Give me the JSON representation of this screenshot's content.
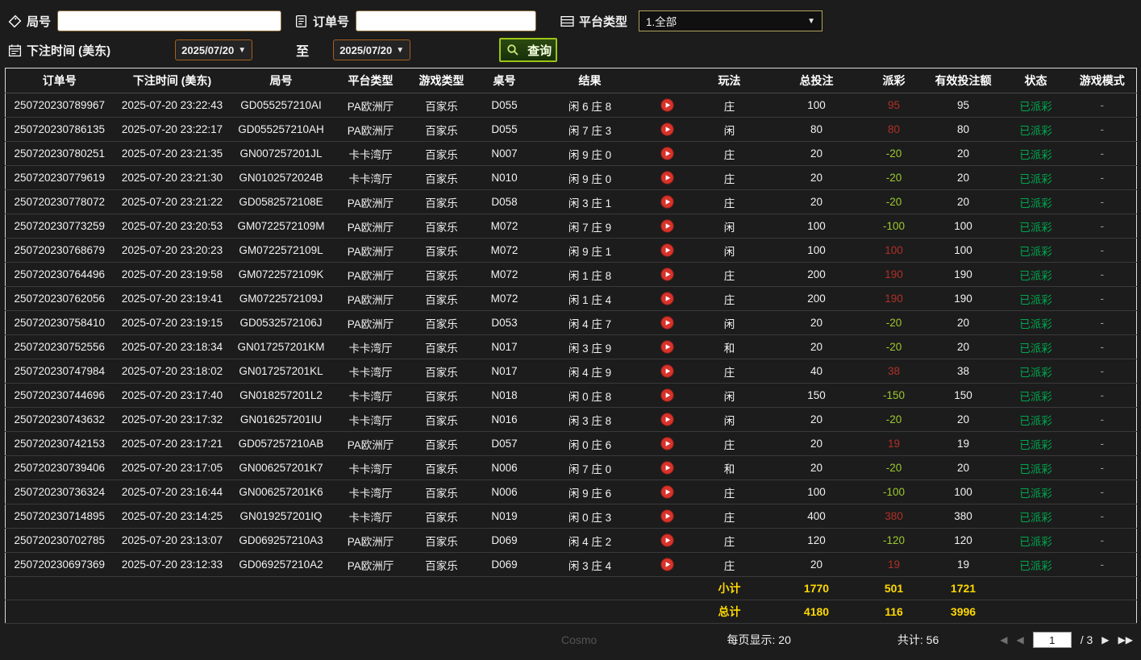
{
  "filters": {
    "round_label": "局号",
    "round_value": "",
    "order_label": "订单号",
    "order_value": "",
    "platform_label": "平台类型",
    "platform_value": "1.全部",
    "bet_time_label": "下注时间 (美东)",
    "date_from": "2025/07/20",
    "to_label": "至",
    "date_to": "2025/07/20",
    "search_label": "查询"
  },
  "table": {
    "headers": [
      "订单号",
      "下注时间 (美东)",
      "局号",
      "平台类型",
      "游戏类型",
      "桌号",
      "结果",
      "",
      "玩法",
      "总投注",
      "派彩",
      "有效投注额",
      "状态",
      "游戏模式"
    ],
    "rows": [
      {
        "order": "250720230789967",
        "time": "2025-07-20 23:22:43",
        "round": "GD055257210AI",
        "platform": "PA欧洲厅",
        "game": "百家乐",
        "table_no": "D055",
        "result": "闲 6 庄 8",
        "play": "庄",
        "total_bet": "100",
        "payout": "95",
        "payout_type": "win",
        "valid_bet": "95",
        "status": "已派彩",
        "mode": "-"
      },
      {
        "order": "250720230786135",
        "time": "2025-07-20 23:22:17",
        "round": "GD055257210AH",
        "platform": "PA欧洲厅",
        "game": "百家乐",
        "table_no": "D055",
        "result": "闲 7 庄 3",
        "play": "闲",
        "total_bet": "80",
        "payout": "80",
        "payout_type": "win",
        "valid_bet": "80",
        "status": "已派彩",
        "mode": "-"
      },
      {
        "order": "250720230780251",
        "time": "2025-07-20 23:21:35",
        "round": "GN007257201JL",
        "platform": "卡卡湾厅",
        "game": "百家乐",
        "table_no": "N007",
        "result": "闲 9 庄 0",
        "play": "庄",
        "total_bet": "20",
        "payout": "-20",
        "payout_type": "loss",
        "valid_bet": "20",
        "status": "已派彩",
        "mode": "-"
      },
      {
        "order": "250720230779619",
        "time": "2025-07-20 23:21:30",
        "round": "GN0102572024B",
        "platform": "卡卡湾厅",
        "game": "百家乐",
        "table_no": "N010",
        "result": "闲 9 庄 0",
        "play": "庄",
        "total_bet": "20",
        "payout": "-20",
        "payout_type": "loss",
        "valid_bet": "20",
        "status": "已派彩",
        "mode": "-"
      },
      {
        "order": "250720230778072",
        "time": "2025-07-20 23:21:22",
        "round": "GD0582572108E",
        "platform": "PA欧洲厅",
        "game": "百家乐",
        "table_no": "D058",
        "result": "闲 3 庄 1",
        "play": "庄",
        "total_bet": "20",
        "payout": "-20",
        "payout_type": "loss",
        "valid_bet": "20",
        "status": "已派彩",
        "mode": "-"
      },
      {
        "order": "250720230773259",
        "time": "2025-07-20 23:20:53",
        "round": "GM0722572109M",
        "platform": "PA欧洲厅",
        "game": "百家乐",
        "table_no": "M072",
        "result": "闲 7 庄 9",
        "play": "闲",
        "total_bet": "100",
        "payout": "-100",
        "payout_type": "loss",
        "valid_bet": "100",
        "status": "已派彩",
        "mode": "-"
      },
      {
        "order": "250720230768679",
        "time": "2025-07-20 23:20:23",
        "round": "GM0722572109L",
        "platform": "PA欧洲厅",
        "game": "百家乐",
        "table_no": "M072",
        "result": "闲 9 庄 1",
        "play": "闲",
        "total_bet": "100",
        "payout": "100",
        "payout_type": "win",
        "valid_bet": "100",
        "status": "已派彩",
        "mode": "-"
      },
      {
        "order": "250720230764496",
        "time": "2025-07-20 23:19:58",
        "round": "GM0722572109K",
        "platform": "PA欧洲厅",
        "game": "百家乐",
        "table_no": "M072",
        "result": "闲 1 庄 8",
        "play": "庄",
        "total_bet": "200",
        "payout": "190",
        "payout_type": "win",
        "valid_bet": "190",
        "status": "已派彩",
        "mode": "-"
      },
      {
        "order": "250720230762056",
        "time": "2025-07-20 23:19:41",
        "round": "GM0722572109J",
        "platform": "PA欧洲厅",
        "game": "百家乐",
        "table_no": "M072",
        "result": "闲 1 庄 4",
        "play": "庄",
        "total_bet": "200",
        "payout": "190",
        "payout_type": "win",
        "valid_bet": "190",
        "status": "已派彩",
        "mode": "-"
      },
      {
        "order": "250720230758410",
        "time": "2025-07-20 23:19:15",
        "round": "GD0532572106J",
        "platform": "PA欧洲厅",
        "game": "百家乐",
        "table_no": "D053",
        "result": "闲 4 庄 7",
        "play": "闲",
        "total_bet": "20",
        "payout": "-20",
        "payout_type": "loss",
        "valid_bet": "20",
        "status": "已派彩",
        "mode": "-"
      },
      {
        "order": "250720230752556",
        "time": "2025-07-20 23:18:34",
        "round": "GN017257201KM",
        "platform": "卡卡湾厅",
        "game": "百家乐",
        "table_no": "N017",
        "result": "闲 3 庄 9",
        "play": "和",
        "total_bet": "20",
        "payout": "-20",
        "payout_type": "loss",
        "valid_bet": "20",
        "status": "已派彩",
        "mode": "-"
      },
      {
        "order": "250720230747984",
        "time": "2025-07-20 23:18:02",
        "round": "GN017257201KL",
        "platform": "卡卡湾厅",
        "game": "百家乐",
        "table_no": "N017",
        "result": "闲 4 庄 9",
        "play": "庄",
        "total_bet": "40",
        "payout": "38",
        "payout_type": "win",
        "valid_bet": "38",
        "status": "已派彩",
        "mode": "-"
      },
      {
        "order": "250720230744696",
        "time": "2025-07-20 23:17:40",
        "round": "GN018257201L2",
        "platform": "卡卡湾厅",
        "game": "百家乐",
        "table_no": "N018",
        "result": "闲 0 庄 8",
        "play": "闲",
        "total_bet": "150",
        "payout": "-150",
        "payout_type": "loss",
        "valid_bet": "150",
        "status": "已派彩",
        "mode": "-"
      },
      {
        "order": "250720230743632",
        "time": "2025-07-20 23:17:32",
        "round": "GN016257201IU",
        "platform": "卡卡湾厅",
        "game": "百家乐",
        "table_no": "N016",
        "result": "闲 3 庄 8",
        "play": "闲",
        "total_bet": "20",
        "payout": "-20",
        "payout_type": "loss",
        "valid_bet": "20",
        "status": "已派彩",
        "mode": "-"
      },
      {
        "order": "250720230742153",
        "time": "2025-07-20 23:17:21",
        "round": "GD057257210AB",
        "platform": "PA欧洲厅",
        "game": "百家乐",
        "table_no": "D057",
        "result": "闲 0 庄 6",
        "play": "庄",
        "total_bet": "20",
        "payout": "19",
        "payout_type": "win",
        "valid_bet": "19",
        "status": "已派彩",
        "mode": "-"
      },
      {
        "order": "250720230739406",
        "time": "2025-07-20 23:17:05",
        "round": "GN006257201K7",
        "platform": "卡卡湾厅",
        "game": "百家乐",
        "table_no": "N006",
        "result": "闲 7 庄 0",
        "play": "和",
        "total_bet": "20",
        "payout": "-20",
        "payout_type": "loss",
        "valid_bet": "20",
        "status": "已派彩",
        "mode": "-"
      },
      {
        "order": "250720230736324",
        "time": "2025-07-20 23:16:44",
        "round": "GN006257201K6",
        "platform": "卡卡湾厅",
        "game": "百家乐",
        "table_no": "N006",
        "result": "闲 9 庄 6",
        "play": "庄",
        "total_bet": "100",
        "payout": "-100",
        "payout_type": "loss",
        "valid_bet": "100",
        "status": "已派彩",
        "mode": "-"
      },
      {
        "order": "250720230714895",
        "time": "2025-07-20 23:14:25",
        "round": "GN019257201IQ",
        "platform": "卡卡湾厅",
        "game": "百家乐",
        "table_no": "N019",
        "result": "闲 0 庄 3",
        "play": "庄",
        "total_bet": "400",
        "payout": "380",
        "payout_type": "win",
        "valid_bet": "380",
        "status": "已派彩",
        "mode": "-"
      },
      {
        "order": "250720230702785",
        "time": "2025-07-20 23:13:07",
        "round": "GD069257210A3",
        "platform": "PA欧洲厅",
        "game": "百家乐",
        "table_no": "D069",
        "result": "闲 4 庄 2",
        "play": "庄",
        "total_bet": "120",
        "payout": "-120",
        "payout_type": "loss",
        "valid_bet": "120",
        "status": "已派彩",
        "mode": "-"
      },
      {
        "order": "250720230697369",
        "time": "2025-07-20 23:12:33",
        "round": "GD069257210A2",
        "platform": "PA欧洲厅",
        "game": "百家乐",
        "table_no": "D069",
        "result": "闲 3 庄 4",
        "play": "庄",
        "total_bet": "20",
        "payout": "19",
        "payout_type": "win",
        "valid_bet": "19",
        "status": "已派彩",
        "mode": "-"
      }
    ],
    "subtotal": {
      "label": "小计",
      "total_bet": "1770",
      "payout": "501",
      "valid_bet": "1721"
    },
    "grand_total": {
      "label": "总计",
      "total_bet": "4180",
      "payout": "116",
      "valid_bet": "3996"
    }
  },
  "footer": {
    "per_page": "每页显示: 20",
    "total_count": "共计: 56",
    "page": "1",
    "page_total": "/ 3"
  },
  "icons": {
    "dropdown_arrow": "▼",
    "first_page": "◀",
    "prev_page": "◀",
    "next_page": "▶",
    "last_page": "▶▶"
  },
  "watermark": "Cosmo",
  "colors": {
    "payout_win": "#b03028",
    "payout_loss": "#9dc92e",
    "status_paid": "#00a84f",
    "summary_yellow": "#ffd800",
    "search_button_border": "#9dc417",
    "play_button_red": "#d7332b",
    "date_picker_border": "#a55f1e"
  }
}
